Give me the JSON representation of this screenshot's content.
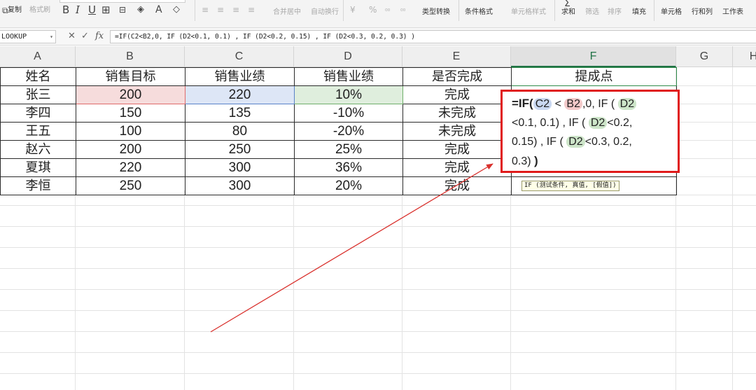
{
  "ribbon": {
    "copy_label": "复制",
    "format_painter_label": "格式刷",
    "bold_glyph": "B",
    "italic_glyph": "I",
    "underline_glyph": "U",
    "merge_center_label": "合并居中",
    "wrap_text_label": "自动换行",
    "currency_glyph": "¥",
    "percent_glyph": "%",
    "type_convert_label": "类型转换",
    "conditional_format_label": "条件格式",
    "cell_style_label": "单元格样式",
    "sum_label": "求和",
    "filter_label": "筛选",
    "sort_label": "排序",
    "fill_label": "填充",
    "cell_label": "单元格",
    "row_col_label": "行和列",
    "worksheet_label": "工作表"
  },
  "formula_bar": {
    "name_box": "LOOKUP",
    "fx_label": "fx",
    "formula": "=IF(C2<B2,0, IF (D2<0.1, 0.1) , IF (D2<0.2, 0.15) , IF (D2<0.3, 0.2, 0.3) )"
  },
  "columns": [
    "A",
    "B",
    "C",
    "D",
    "E",
    "F",
    "G",
    "H"
  ],
  "table": {
    "headers": [
      "姓名",
      "销售目标",
      "销售业绩",
      "销售业绩",
      "是否完成",
      "提成点"
    ],
    "rows": [
      [
        "张三",
        "200",
        "220",
        "10%",
        "完成",
        ""
      ],
      [
        "李四",
        "150",
        "135",
        "-10%",
        "未完成",
        ""
      ],
      [
        "王五",
        "100",
        "80",
        "-20%",
        "未完成",
        ""
      ],
      [
        "赵六",
        "200",
        "250",
        "25%",
        "完成",
        ""
      ],
      [
        "夏琪",
        "220",
        "300",
        "36%",
        "完成",
        ""
      ],
      [
        "李恒",
        "250",
        "300",
        "20%",
        "完成",
        ""
      ]
    ]
  },
  "editor": {
    "eq_if": "=IF(",
    "c2": "C2",
    "lt": "<",
    "b2": "B2",
    "zero": ",0,",
    "if2": " IF ",
    "open2": "(",
    "d2_a": "D2",
    "line2": "<0.1, 0.1) , IF ",
    "open3": "(",
    "d2_b": "D2",
    "lt02": "<0.2,",
    "line3": "0.15) , IF ",
    "open4": "(",
    "d2_c": "D2",
    "lt03": "<0.3, 0.2,",
    "line4": "0.3) ",
    "close": ")"
  },
  "tooltip": "IF (测试条件, 真值, [假值])",
  "colors": {
    "highlight_box": "#e01b1b",
    "arrow": "#d9302c",
    "ref_blue": "#c9d8f1",
    "ref_red": "#f2c9c9",
    "ref_green": "#cde5c9"
  }
}
